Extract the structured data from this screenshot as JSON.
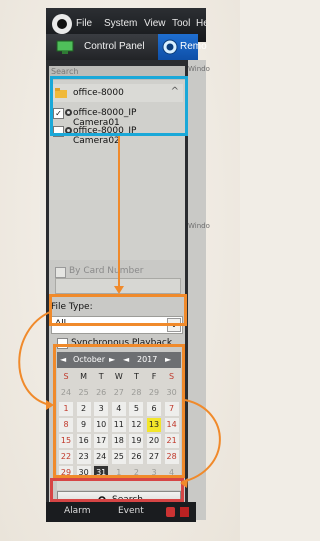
{
  "header": {
    "menu": [
      "File",
      "System",
      "View",
      "Tool",
      "He"
    ],
    "tab_control_panel": "Control Panel",
    "tab_remote": "Remo"
  },
  "sidebar": {
    "search_placeholder": "Search",
    "tree": {
      "group": "office-8000",
      "cameras": [
        {
          "label": "office-8000_IP Camera01",
          "checked": true
        },
        {
          "label": "office-8000_IP Camera02",
          "checked": false
        }
      ]
    },
    "by_card_number_label": "By Card Number",
    "file_type_label": "File Type:",
    "file_type_value": "All",
    "sync_playback_label": "Synchronous Playback",
    "search_button_label": "Search"
  },
  "calendar": {
    "month": "October",
    "year": "2017",
    "weekdays": [
      "S",
      "M",
      "T",
      "W",
      "T",
      "F",
      "S"
    ],
    "weeks": [
      [
        "24",
        "25",
        "26",
        "27",
        "28",
        "29",
        "30"
      ],
      [
        "1",
        "2",
        "3",
        "4",
        "5",
        "6",
        "7"
      ],
      [
        "8",
        "9",
        "10",
        "11",
        "12",
        "13",
        "14"
      ],
      [
        "15",
        "16",
        "17",
        "18",
        "19",
        "20",
        "21"
      ],
      [
        "22",
        "23",
        "24",
        "25",
        "26",
        "27",
        "28"
      ],
      [
        "29",
        "30",
        "31",
        "1",
        "2",
        "3",
        "4"
      ]
    ],
    "selected_day": "13",
    "colors": {
      "sunday_red": "#c0392b",
      "selected_yellow": "#f3e62a",
      "today_dark": "#333333"
    }
  },
  "bottom_bar": {
    "alarm": "Alarm",
    "event": "Event"
  },
  "windows": [
    "Windo",
    "Windo"
  ],
  "colors": {
    "accent_blue": "#1aa8d8",
    "accent_orange": "#f08a2b",
    "accent_red": "#d64545",
    "remote_tab_blue": "#1f6fd1"
  }
}
